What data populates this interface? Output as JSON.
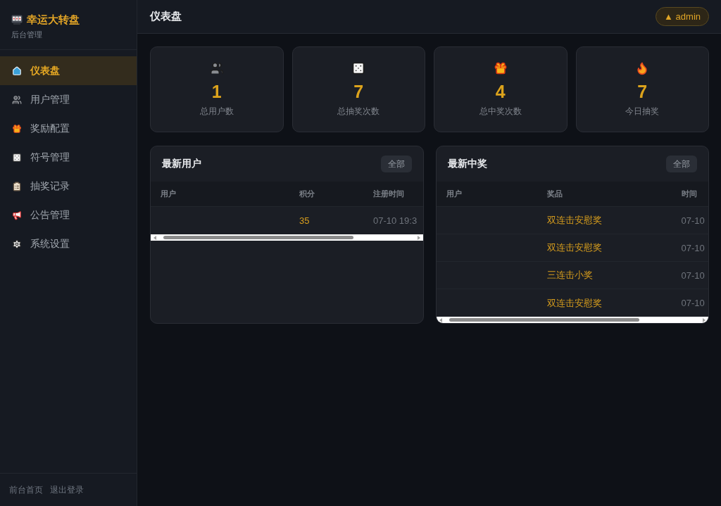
{
  "sidebar": {
    "brand": "幸运大转盘",
    "subtitle": "后台管理",
    "items": [
      {
        "label": "仪表盘",
        "selected": true
      },
      {
        "label": "用户管理",
        "selected": false
      },
      {
        "label": "奖励配置",
        "selected": false
      },
      {
        "label": "符号管理",
        "selected": false
      },
      {
        "label": "抽奖记录",
        "selected": false
      },
      {
        "label": "公告管理",
        "selected": false
      },
      {
        "label": "系统设置",
        "selected": false
      }
    ],
    "footer_links": [
      "前台首页",
      "退出登录"
    ]
  },
  "header": {
    "title": "仪表盘",
    "user_badge": "▲ admin"
  },
  "stats": [
    {
      "value": "1",
      "label": "总用户数"
    },
    {
      "value": "7",
      "label": "总抽奖次数"
    },
    {
      "value": "4",
      "label": "总中奖次数"
    },
    {
      "value": "7",
      "label": "今日抽奖"
    }
  ],
  "panels": [
    {
      "title": "最新用户",
      "button": "全部",
      "columns": [
        "用户",
        "积分",
        "注册时间"
      ],
      "rows": [
        {
          "cells": [
            null,
            "35",
            "07-10 19:3"
          ]
        }
      ]
    },
    {
      "title": "最新中奖",
      "button": "全部",
      "columns": [
        "用户",
        "奖品",
        "时间"
      ],
      "rows": [
        {
          "cells": [
            null,
            "双连击安慰奖",
            "07-10"
          ]
        },
        {
          "cells": [
            null,
            "双连击安慰奖",
            "07-10"
          ]
        },
        {
          "cells": [
            null,
            "三连击小奖",
            "07-10"
          ]
        },
        {
          "cells": [
            null,
            "双连击安慰奖",
            "07-10"
          ]
        }
      ]
    }
  ]
}
